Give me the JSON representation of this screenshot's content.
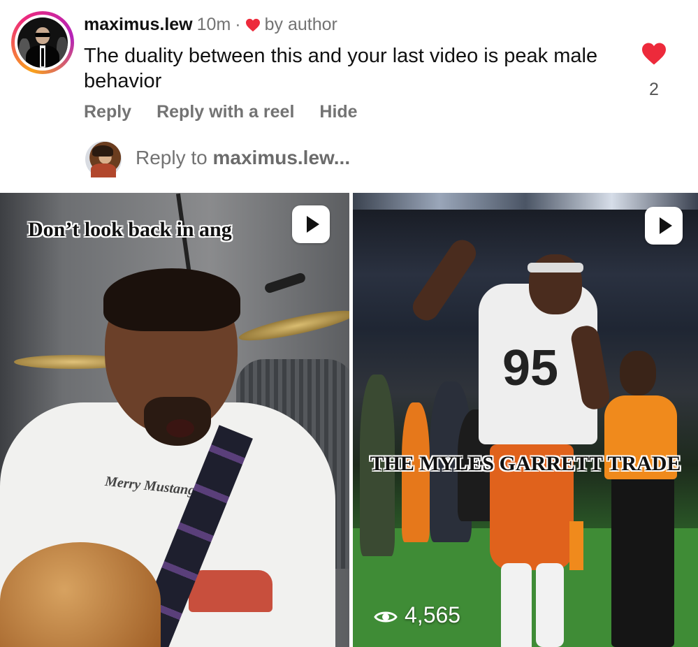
{
  "comment": {
    "username": "maximus.lew",
    "time": "10m",
    "separator": "·",
    "liked_by": "by author",
    "text": "The duality between this and your last video is peak male behavior",
    "like_count": "2",
    "heart_color": "#ed2a3b"
  },
  "actions": {
    "reply": "Reply",
    "reply_with_reel": "Reply with a reel",
    "hide": "Hide"
  },
  "reply_box": {
    "prefix": "Reply to ",
    "target": "maximus.lew..."
  },
  "reels": [
    {
      "caption": "Don’t look back in ang",
      "shirt_text": "Merry Mustang!"
    },
    {
      "caption": "THE MYLES GARRETT TRADE",
      "jersey_number": "95",
      "views": "4,565"
    }
  ]
}
